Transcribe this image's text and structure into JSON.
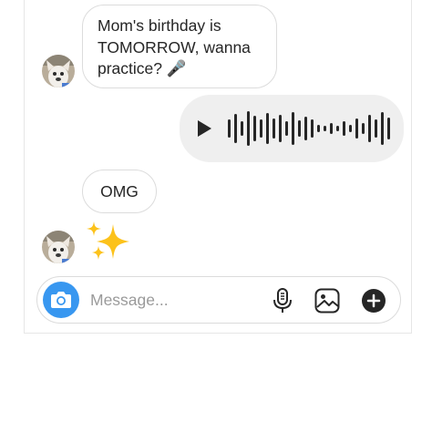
{
  "messages": [
    {
      "type": "incoming",
      "text_lines": [
        "Mom's birthday is",
        "TOMORROW, wanna",
        "practice? 🎤"
      ]
    },
    {
      "type": "outgoing-voice"
    },
    {
      "type": "incoming",
      "text": "OMG"
    },
    {
      "type": "incoming-emoji",
      "emoji": "sparkles"
    }
  ],
  "composer": {
    "placeholder": "Message..."
  },
  "icons": {
    "camera": "camera-icon",
    "mic": "microphone-icon",
    "gallery": "image-icon",
    "add": "plus-icon",
    "play": "play-icon"
  },
  "colors": {
    "accent": "#3897f0",
    "voice_bubble": "#efefef",
    "text": "#262626"
  }
}
